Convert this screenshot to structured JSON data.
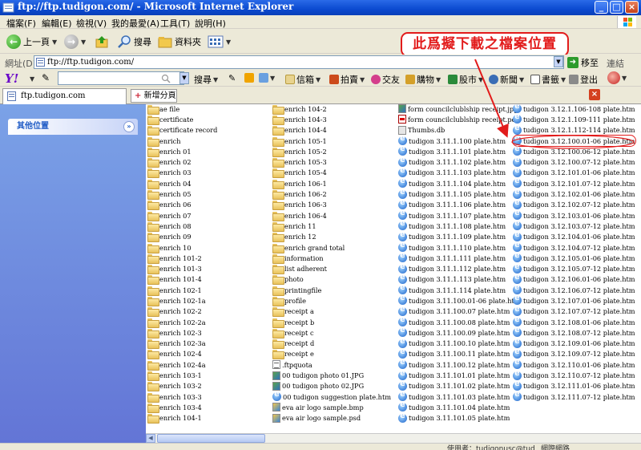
{
  "window": {
    "title": "ftp://ftp.tudigon.com/ - Microsoft Internet Explorer",
    "buttons": {
      "minimize": "_",
      "maximize": "□",
      "close": "×"
    }
  },
  "menu": [
    "檔案(F)",
    "編輯(E)",
    "檢視(V)",
    "我的最愛(A)",
    "工具(T)",
    "說明(H)"
  ],
  "toolbar": {
    "back_label": "上一頁",
    "search_label": "搜尋",
    "folders_label": "資料夾"
  },
  "callout": {
    "text": "此爲擬下載之檔案位置"
  },
  "address": {
    "label": "網址(D)",
    "value": "ftp://ftp.tudigon.com/",
    "go_label": "移至",
    "links_label": "連結"
  },
  "yahoo_toolbar": {
    "search_value": "",
    "search_button": "搜尋",
    "items": [
      "信箱",
      "拍賣",
      "交友",
      "購物",
      "股市",
      "新聞",
      "書籤",
      "登出"
    ]
  },
  "tabs": {
    "active": "ftp.tudigon.com",
    "new_tab": "新增分頁",
    "close": "×"
  },
  "left_pane": {
    "other_places": "其他位置"
  },
  "files": {
    "col1": [
      {
        "name": "ae file",
        "type": "folder"
      },
      {
        "name": "certificate",
        "type": "folder"
      },
      {
        "name": "certificate record",
        "type": "folder"
      },
      {
        "name": "enrich",
        "type": "folder"
      },
      {
        "name": "enrich 01",
        "type": "folder"
      },
      {
        "name": "enrich 02",
        "type": "folder"
      },
      {
        "name": "enrich 03",
        "type": "folder"
      },
      {
        "name": "enrich 04",
        "type": "folder"
      },
      {
        "name": "enrich 05",
        "type": "folder"
      },
      {
        "name": "enrich 06",
        "type": "folder"
      },
      {
        "name": "enrich 07",
        "type": "folder"
      },
      {
        "name": "enrich 08",
        "type": "folder"
      },
      {
        "name": "enrich 09",
        "type": "folder"
      },
      {
        "name": "enrich 10",
        "type": "folder"
      },
      {
        "name": "enrich 101-2",
        "type": "folder"
      },
      {
        "name": "enrich 101-3",
        "type": "folder"
      },
      {
        "name": "enrich 101-4",
        "type": "folder"
      },
      {
        "name": "enrich 102-1",
        "type": "folder"
      },
      {
        "name": "enrich 102-1a",
        "type": "folder"
      },
      {
        "name": "enrich 102-2",
        "type": "folder"
      },
      {
        "name": "enrich 102-2a",
        "type": "folder"
      },
      {
        "name": "enrich 102-3",
        "type": "folder"
      },
      {
        "name": "enrich 102-3a",
        "type": "folder"
      },
      {
        "name": "enrich 102-4",
        "type": "folder"
      },
      {
        "name": "enrich 102-4a",
        "type": "folder"
      },
      {
        "name": "enrich 103-1",
        "type": "folder"
      },
      {
        "name": "enrich 103-2",
        "type": "folder"
      },
      {
        "name": "enrich 103-3",
        "type": "folder"
      },
      {
        "name": "enrich 103-4",
        "type": "folder"
      },
      {
        "name": "enrich 104-1",
        "type": "folder"
      }
    ],
    "col2": [
      {
        "name": "enrich 104-2",
        "type": "folder"
      },
      {
        "name": "enrich 104-3",
        "type": "folder"
      },
      {
        "name": "enrich 104-4",
        "type": "folder"
      },
      {
        "name": "enrich 105-1",
        "type": "folder"
      },
      {
        "name": "enrich 105-2",
        "type": "folder"
      },
      {
        "name": "enrich 105-3",
        "type": "folder"
      },
      {
        "name": "enrich 105-4",
        "type": "folder"
      },
      {
        "name": "enrich 106-1",
        "type": "folder"
      },
      {
        "name": "enrich 106-2",
        "type": "folder"
      },
      {
        "name": "enrich 106-3",
        "type": "folder"
      },
      {
        "name": "enrich 106-4",
        "type": "folder"
      },
      {
        "name": "enrich 11",
        "type": "folder"
      },
      {
        "name": "enrich 12",
        "type": "folder"
      },
      {
        "name": "enrich grand total",
        "type": "folder"
      },
      {
        "name": "information",
        "type": "folder"
      },
      {
        "name": "list adherent",
        "type": "folder"
      },
      {
        "name": "photo",
        "type": "folder"
      },
      {
        "name": "printingfile",
        "type": "folder"
      },
      {
        "name": "profile",
        "type": "folder"
      },
      {
        "name": "receipt a",
        "type": "folder"
      },
      {
        "name": "receipt b",
        "type": "folder"
      },
      {
        "name": "receipt c",
        "type": "folder"
      },
      {
        "name": "receipt d",
        "type": "folder"
      },
      {
        "name": "receipt e",
        "type": "folder"
      },
      {
        "name": ".ftpquota",
        "type": "txt"
      },
      {
        "name": "00 tudigon photo 01.JPG",
        "type": "jpg"
      },
      {
        "name": "00 tudigon photo 02.JPG",
        "type": "jpg"
      },
      {
        "name": "00 tudigon suggestion plate.htm",
        "type": "htm"
      },
      {
        "name": "eva air logo  sample.bmp",
        "type": "img"
      },
      {
        "name": "eva air logo  sample.psd",
        "type": "img"
      }
    ],
    "col3": [
      {
        "name": "form councilclublship receipt.jpg",
        "type": "jpg"
      },
      {
        "name": "form councilclublship receipt.pdf",
        "type": "pdf"
      },
      {
        "name": "Thumbs.db",
        "type": "db"
      },
      {
        "name": "tudigon 3.11.1.100 plate.htm",
        "type": "htm"
      },
      {
        "name": "tudigon 3.11.1.101 plate.htm",
        "type": "htm"
      },
      {
        "name": "tudigon 3.11.1.102 plate.htm",
        "type": "htm"
      },
      {
        "name": "tudigon 3.11.1.103 plate.htm",
        "type": "htm"
      },
      {
        "name": "tudigon 3.11.1.104 plate.htm",
        "type": "htm"
      },
      {
        "name": "tudigon 3.11.1.105 plate.htm",
        "type": "htm"
      },
      {
        "name": "tudigon 3.11.1.106 plate.htm",
        "type": "htm"
      },
      {
        "name": "tudigon 3.11.1.107 plate.htm",
        "type": "htm"
      },
      {
        "name": "tudigon 3.11.1.108 plate.htm",
        "type": "htm"
      },
      {
        "name": "tudigon 3.11.1.109 plate.htm",
        "type": "htm"
      },
      {
        "name": "tudigon 3.11.1.110 plate.htm",
        "type": "htm"
      },
      {
        "name": "tudigon 3.11.1.111 plate.htm",
        "type": "htm"
      },
      {
        "name": "tudigon 3.11.1.112 plate.htm",
        "type": "htm"
      },
      {
        "name": "tudigon 3.11.1.113 plate.htm",
        "type": "htm"
      },
      {
        "name": "tudigon 3.11.1.114 plate.htm",
        "type": "htm"
      },
      {
        "name": "tudigon 3.11.100.01-06 plate.htm",
        "type": "htm"
      },
      {
        "name": "tudigon 3.11.100.07 plate.htm",
        "type": "htm"
      },
      {
        "name": "tudigon 3.11.100.08 plate.htm",
        "type": "htm"
      },
      {
        "name": "tudigon 3.11.100.09 plate.htm",
        "type": "htm"
      },
      {
        "name": "tudigon 3.11.100.10 plate.htm",
        "type": "htm"
      },
      {
        "name": "tudigon 3.11.100.11 plate.htm",
        "type": "htm"
      },
      {
        "name": "tudigon 3.11.100.12 plate.htm",
        "type": "htm"
      },
      {
        "name": "tudigon 3.11.101.01 plate.htm",
        "type": "htm"
      },
      {
        "name": "tudigon 3.11.101.02 plate.htm",
        "type": "htm"
      },
      {
        "name": "tudigon 3.11.101.03 plate.htm",
        "type": "htm"
      },
      {
        "name": "tudigon 3.11.101.04 plate.htm",
        "type": "htm"
      },
      {
        "name": "tudigon 3.11.101.05 plate.htm",
        "type": "htm"
      }
    ],
    "col4": [
      {
        "name": "tudigon 3.12.1.106-108 plate.htm",
        "type": "htm"
      },
      {
        "name": "tudigon 3.12.1.109-111 plate.htm",
        "type": "htm"
      },
      {
        "name": "tudigon 3.12.1.112-114 plate.htm",
        "type": "htm"
      },
      {
        "name": "tudigon 3.12.100.01-06 plate.htm",
        "type": "htm",
        "highlight": true
      },
      {
        "name": "tudigon 3.12.100.06-12 plate.htm",
        "type": "htm"
      },
      {
        "name": "tudigon 3.12.100.07-12 plate.htm",
        "type": "htm"
      },
      {
        "name": "tudigon 3.12.101.01-06 plate.htm",
        "type": "htm"
      },
      {
        "name": "tudigon 3.12.101.07-12 plate.htm",
        "type": "htm"
      },
      {
        "name": "tudigon 3.12.102.01-06 plate.htm",
        "type": "htm"
      },
      {
        "name": "tudigon 3.12.102.07-12 plate.htm",
        "type": "htm"
      },
      {
        "name": "tudigon 3.12.103.01-06 plate.htm",
        "type": "htm"
      },
      {
        "name": "tudigon 3.12.103.07-12 plate.htm",
        "type": "htm"
      },
      {
        "name": "tudigon 3.12.104.01-06 plate.htm",
        "type": "htm"
      },
      {
        "name": "tudigon 3.12.104.07-12 plate.htm",
        "type": "htm"
      },
      {
        "name": "tudigon 3.12.105.01-06 plate.htm",
        "type": "htm"
      },
      {
        "name": "tudigon 3.12.105.07-12 plate.htm",
        "type": "htm"
      },
      {
        "name": "tudigon 3.12.106.01-06 plate.htm",
        "type": "htm"
      },
      {
        "name": "tudigon 3.12.106.07-12 plate.htm",
        "type": "htm"
      },
      {
        "name": "tudigon 3.12.107.01-06 plate.htm",
        "type": "htm"
      },
      {
        "name": "tudigon 3.12.107.07-12 plate.htm",
        "type": "htm"
      },
      {
        "name": "tudigon 3.12.108.01-06 plate.htm",
        "type": "htm"
      },
      {
        "name": "tudigon 3.12.108.07-12 plate.htm",
        "type": "htm"
      },
      {
        "name": "tudigon 3.12.109.01-06 plate.htm",
        "type": "htm"
      },
      {
        "name": "tudigon 3.12.109.07-12 plate.htm",
        "type": "htm"
      },
      {
        "name": "tudigon 3.12.110.01-06 plate.htm",
        "type": "htm"
      },
      {
        "name": "tudigon 3.12.110.07-12 plate.htm",
        "type": "htm"
      },
      {
        "name": "tudigon 3.12.111.01-06 plate.htm",
        "type": "htm"
      },
      {
        "name": "tudigon 3.12.111.07-12 plate.htm",
        "type": "htm"
      }
    ]
  },
  "status": {
    "user": "使用者：tudigonusc@tud",
    "zone": "網際網路"
  },
  "colors": {
    "title_bar": "#0b4ad0",
    "annotation_red": "#e21b1b",
    "left_pane": "#7ba2e7"
  }
}
